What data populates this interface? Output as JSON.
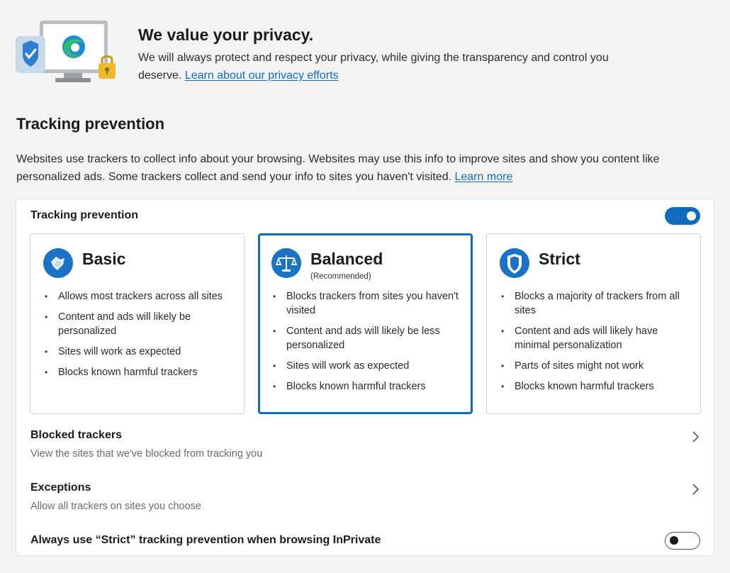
{
  "hero": {
    "title": "We value your privacy.",
    "text": "We will always protect and respect your privacy, while giving the transparency and control you deserve.",
    "link": "Learn about our privacy efforts"
  },
  "section": {
    "title": "Tracking prevention",
    "description": "Websites use trackers to collect info about your browsing. Websites may use this info to improve sites and show you content like personalized ads. Some trackers collect and send your info to sites you haven't visited.",
    "link": "Learn more"
  },
  "panel": {
    "label": "Tracking prevention",
    "toggle_on": true
  },
  "cards": [
    {
      "title": "Basic",
      "subtitle": "",
      "icon": "basic-shield-icon",
      "selected": false,
      "bullets": [
        "Allows most trackers across all sites",
        "Content and ads will likely be personalized",
        "Sites will work as expected",
        "Blocks known harmful trackers"
      ]
    },
    {
      "title": "Balanced",
      "subtitle": "(Recommended)",
      "icon": "balance-scale-icon",
      "selected": true,
      "bullets": [
        "Blocks trackers from sites you haven't visited",
        "Content and ads will likely be less personalized",
        "Sites will work as expected",
        "Blocks known harmful trackers"
      ]
    },
    {
      "title": "Strict",
      "subtitle": "",
      "icon": "shield-icon",
      "selected": false,
      "bullets": [
        "Blocks a majority of trackers from all sites",
        "Content and ads will likely have minimal personalization",
        "Parts of sites might not work",
        "Blocks known harmful trackers"
      ]
    }
  ],
  "blocked": {
    "title": "Blocked trackers",
    "description": "View the sites that we've blocked from tracking you"
  },
  "exceptions": {
    "title": "Exceptions",
    "description": "Allow all trackers on sites you choose"
  },
  "inprivate": {
    "label": "Always use “Strict” tracking prevention when browsing InPrivate",
    "toggle_on": false
  },
  "colors": {
    "accent": "#0f6cbd",
    "background": "#f3f3f3",
    "card": "#ffffff"
  }
}
